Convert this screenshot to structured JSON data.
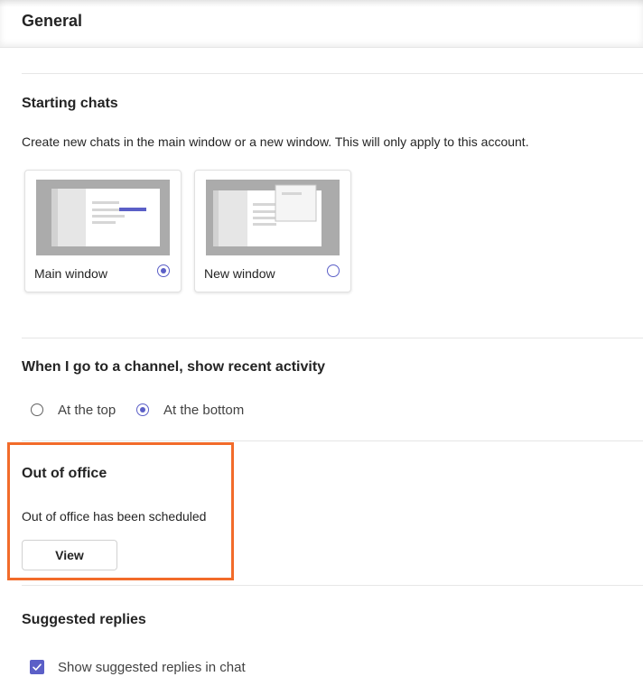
{
  "header": {
    "title": "General"
  },
  "starting_chats": {
    "title": "Starting chats",
    "description": "Create new chats in the main window or a new window. This will only apply to this account.",
    "options": [
      {
        "label": "Main window",
        "selected": true
      },
      {
        "label": "New window",
        "selected": false
      }
    ]
  },
  "channel_activity": {
    "title": "When I go to a channel, show recent activity",
    "options": [
      {
        "label": "At the top",
        "selected": false
      },
      {
        "label": "At the bottom",
        "selected": true
      }
    ]
  },
  "out_of_office": {
    "title": "Out of office",
    "status": "Out of office has been scheduled",
    "view_label": "View"
  },
  "suggested_replies": {
    "title": "Suggested replies",
    "checkbox_label": "Show suggested replies in chat",
    "checked": true
  },
  "colors": {
    "accent": "#5b5fc7",
    "highlight": "#f26b2a"
  }
}
